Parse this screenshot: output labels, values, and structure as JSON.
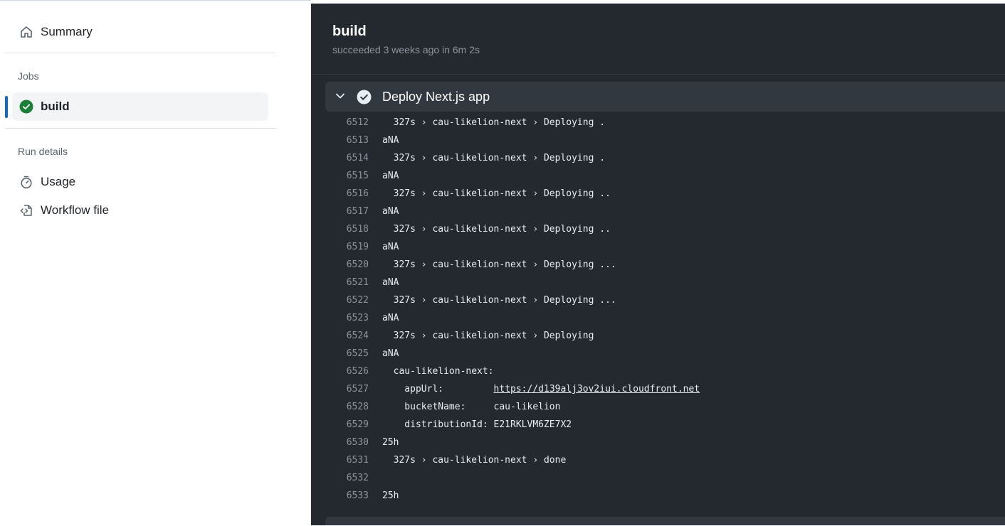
{
  "sidebar": {
    "summary_label": "Summary",
    "jobs_heading": "Jobs",
    "job_name": "build",
    "run_details_heading": "Run details",
    "usage_label": "Usage",
    "workflow_file_label": "Workflow file"
  },
  "job": {
    "title": "build",
    "status": "succeeded 3 weeks ago in 6m 2s"
  },
  "step": {
    "label": "Deploy Next.js app"
  },
  "log_lines": [
    {
      "n": "6512",
      "t": "  327s › cau-likelion-next › Deploying ."
    },
    {
      "n": "6513",
      "t": "aNA"
    },
    {
      "n": "6514",
      "t": "  327s › cau-likelion-next › Deploying ."
    },
    {
      "n": "6515",
      "t": "aNA"
    },
    {
      "n": "6516",
      "t": "  327s › cau-likelion-next › Deploying .."
    },
    {
      "n": "6517",
      "t": "aNA"
    },
    {
      "n": "6518",
      "t": "  327s › cau-likelion-next › Deploying .."
    },
    {
      "n": "6519",
      "t": "aNA"
    },
    {
      "n": "6520",
      "t": "  327s › cau-likelion-next › Deploying ..."
    },
    {
      "n": "6521",
      "t": "aNA"
    },
    {
      "n": "6522",
      "t": "  327s › cau-likelion-next › Deploying ..."
    },
    {
      "n": "6523",
      "t": "aNA"
    },
    {
      "n": "6524",
      "t": "  327s › cau-likelion-next › Deploying"
    },
    {
      "n": "6525",
      "t": "aNA"
    },
    {
      "n": "6526",
      "t": "  cau-likelion-next:"
    },
    {
      "n": "6527",
      "t": "    appUrl:         ",
      "link": "https://d139alj3ov2iui.cloudfront.net"
    },
    {
      "n": "6528",
      "t": "    bucketName:     cau-likelion"
    },
    {
      "n": "6529",
      "t": "    distributionId: E21RKLVM6ZE7X2"
    },
    {
      "n": "6530",
      "t": "25h"
    },
    {
      "n": "6531",
      "t": "  327s › cau-likelion-next › done"
    },
    {
      "n": "6532",
      "t": ""
    },
    {
      "n": "6533",
      "t": "25h"
    }
  ],
  "colors": {
    "accent": "#0969da",
    "success": "#1a7f37",
    "log_bg": "#24292f"
  }
}
